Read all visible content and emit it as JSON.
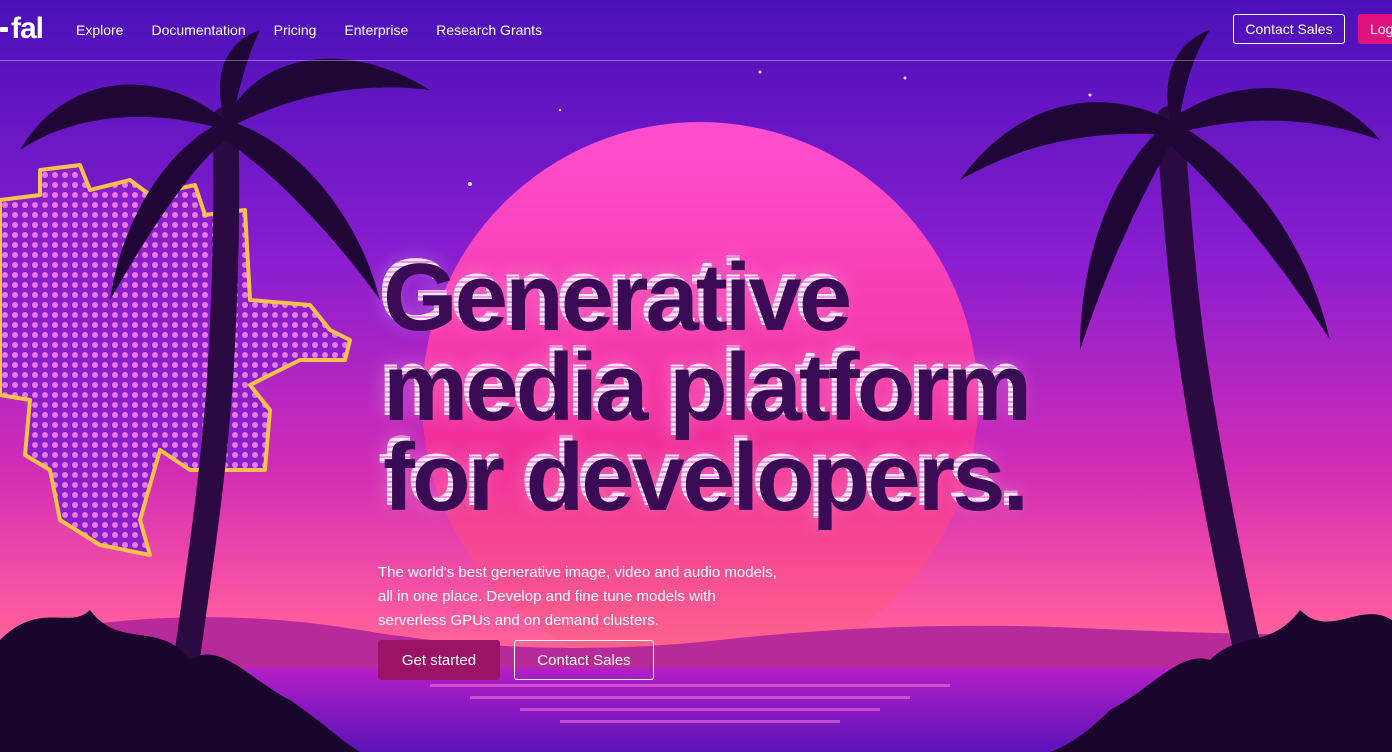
{
  "nav": {
    "logo": "fal",
    "links": [
      "Explore",
      "Documentation",
      "Pricing",
      "Enterprise",
      "Research Grants"
    ],
    "contact_sales": "Contact Sales",
    "login": "Log"
  },
  "hero": {
    "headline": [
      "Generative",
      "media platform",
      "for developers."
    ],
    "subtext": "The world's best generative image, video and audio models, all in one place. Develop and fine tune models with serverless GPUs and on demand clusters.",
    "primary_cta": "Get started",
    "secondary_cta": "Contact Sales"
  },
  "colors": {
    "accent": "#e0127e",
    "primary_button": "#9b1266",
    "sky_top": "#4a10b8",
    "sun": "#f03cb4"
  }
}
